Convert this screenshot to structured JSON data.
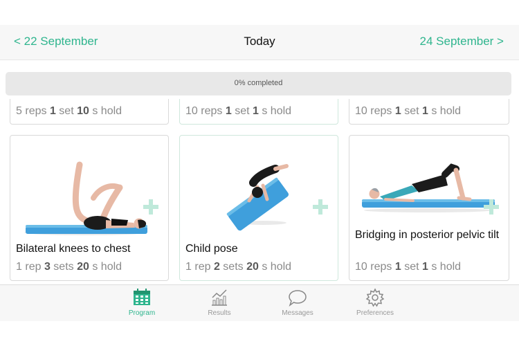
{
  "header": {
    "prev_label": "< 22 September",
    "title": "Today",
    "next_label": "24 September >"
  },
  "progress": {
    "text": "0% completed",
    "value": 0
  },
  "colors": {
    "accent": "#2fb58e",
    "mat": "#3f9fdc",
    "plus": "#bfe9da"
  },
  "top_cards": [
    {
      "reps_num": "5",
      "reps_unit": "reps",
      "sets_num": "1",
      "sets_unit": "set",
      "hold_num": "10",
      "hold_unit": "s hold"
    },
    {
      "reps_num": "10",
      "reps_unit": "reps",
      "sets_num": "1",
      "sets_unit": "set",
      "hold_num": "1",
      "hold_unit": "s hold"
    },
    {
      "reps_num": "10",
      "reps_unit": "reps",
      "sets_num": "1",
      "sets_unit": "set",
      "hold_num": "1",
      "hold_unit": "s hold"
    }
  ],
  "cards": [
    {
      "title": "Bilateral knees to chest",
      "reps_num": "1",
      "reps_unit": "rep",
      "sets_num": "3",
      "sets_unit": "sets",
      "hold_num": "20",
      "hold_unit": "s hold",
      "icon": "plus-icon"
    },
    {
      "title": "Child pose",
      "reps_num": "1",
      "reps_unit": "rep",
      "sets_num": "2",
      "sets_unit": "sets",
      "hold_num": "20",
      "hold_unit": "s hold",
      "icon": "plus-icon"
    },
    {
      "title": "Bridging in posterior pelvic tilt",
      "reps_num": "10",
      "reps_unit": "reps",
      "sets_num": "1",
      "sets_unit": "set",
      "hold_num": "1",
      "hold_unit": "s hold",
      "icon": "plus-icon"
    }
  ],
  "tabs": [
    {
      "label": "Program",
      "icon": "calendar-icon",
      "active": true
    },
    {
      "label": "Results",
      "icon": "chart-icon",
      "active": false
    },
    {
      "label": "Messages",
      "icon": "chat-bubble-icon",
      "active": false
    },
    {
      "label": "Preferences",
      "icon": "gear-icon",
      "active": false
    }
  ]
}
